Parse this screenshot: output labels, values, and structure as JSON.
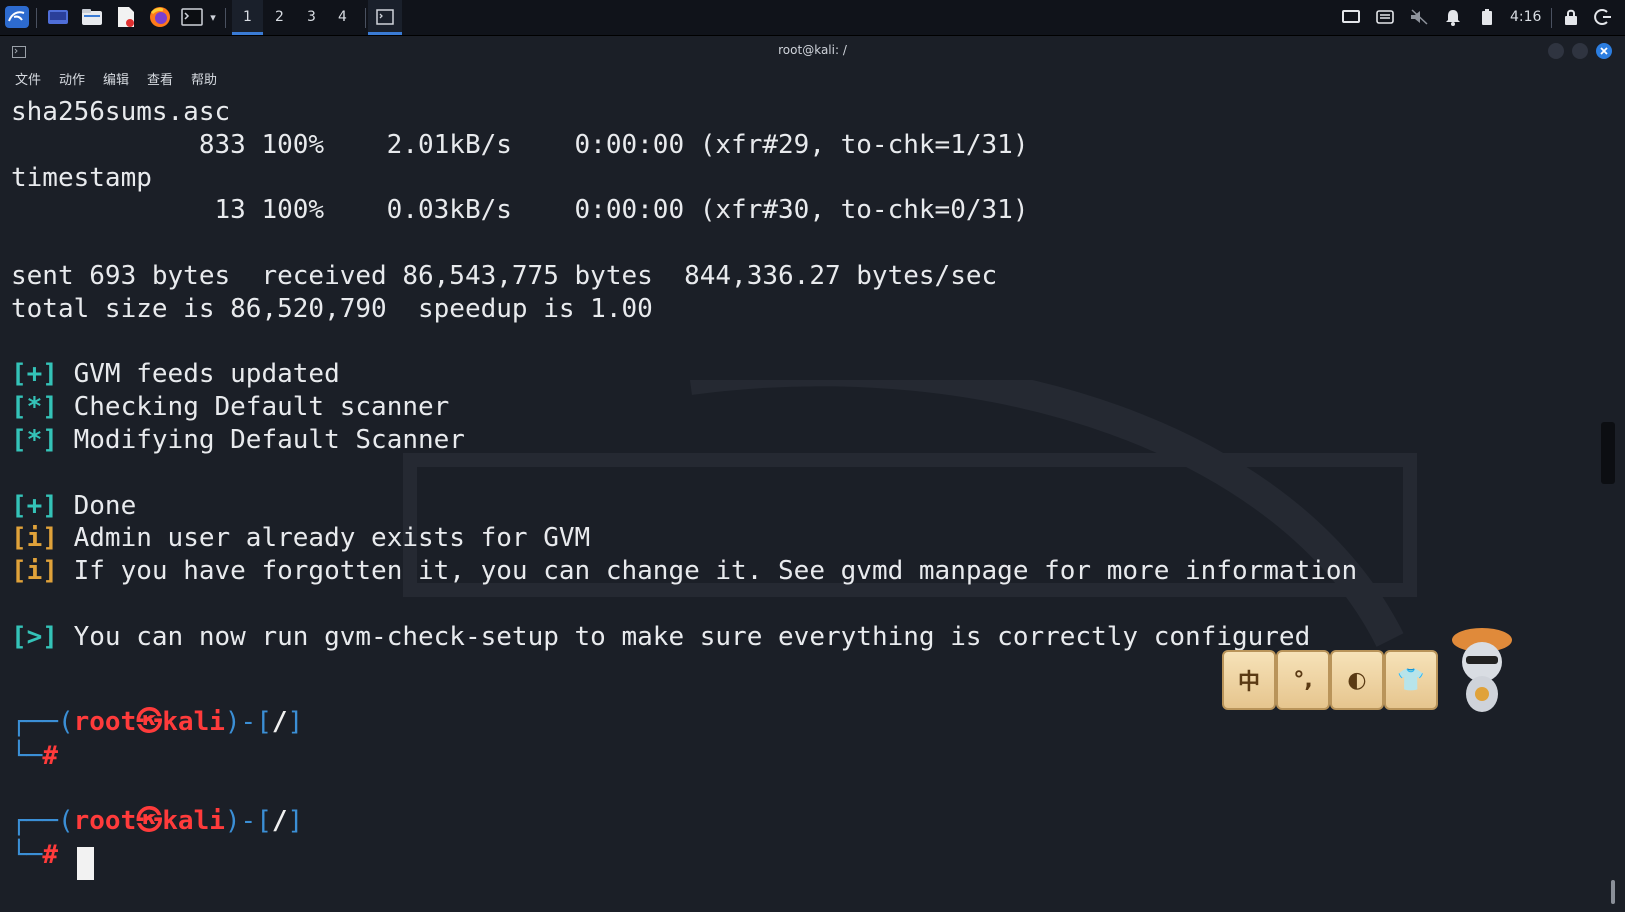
{
  "panel": {
    "workspaces": [
      "1",
      "2",
      "3",
      "4"
    ],
    "active_workspace": "1",
    "clock": "4:16"
  },
  "window": {
    "title": "root@kali: /"
  },
  "menu": {
    "items": [
      "文件",
      "动作",
      "编辑",
      "查看",
      "帮助"
    ]
  },
  "terminal": {
    "lines": [
      {
        "text": "sha256sums.asc"
      },
      {
        "text": "            833 100%    2.01kB/s    0:00:00 (xfr#29, to-chk=1/31)"
      },
      {
        "text": "timestamp"
      },
      {
        "text": "             13 100%    0.03kB/s    0:00:00 (xfr#30, to-chk=0/31)"
      },
      {
        "text": ""
      },
      {
        "text": "sent 693 bytes  received 86,543,775 bytes  844,336.27 bytes/sec"
      },
      {
        "text": "total size is 86,520,790  speedup is 1.00"
      },
      {
        "text": ""
      },
      {
        "tag": "[+]",
        "tagcolor": "cyan",
        "text": " GVM feeds updated"
      },
      {
        "tag": "[*]",
        "tagcolor": "cyan",
        "text": " Checking Default scanner"
      },
      {
        "tag": "[*]",
        "tagcolor": "cyan",
        "text": " Modifying Default Scanner"
      },
      {
        "text": ""
      },
      {
        "tag": "[+]",
        "tagcolor": "cyan",
        "text": " Done"
      },
      {
        "tag": "[i]",
        "tagcolor": "amber",
        "text": " Admin user already exists for GVM"
      },
      {
        "tag": "[i]",
        "tagcolor": "amber",
        "text": " If you have forgotten it, you can change it. See gvmd manpage for more information"
      },
      {
        "text": ""
      },
      {
        "tag": "[>]",
        "tagcolor": "cyan",
        "text": " You can now run gvm-check-setup to make sure everything is correctly configured"
      }
    ],
    "prompt": {
      "user": "root",
      "at_symbol": "㉿",
      "host": "kali",
      "cwd": "/",
      "symbol": "#"
    }
  },
  "widget": {
    "cards": [
      "中",
      "°,",
      "◐",
      "👕"
    ]
  },
  "colors": {
    "cyan": "#34c3b8",
    "amber": "#e0a23a",
    "prompt_red": "#ff3b3b",
    "prompt_blue": "#3b8fd6",
    "accent": "#3a7bd5"
  }
}
